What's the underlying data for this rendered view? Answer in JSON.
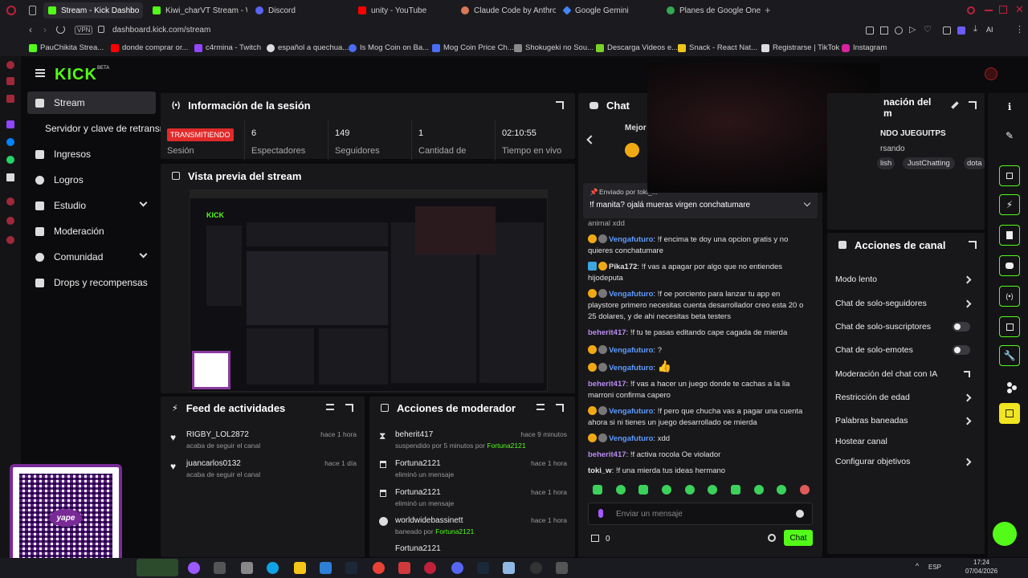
{
  "browser": {
    "tabs": [
      {
        "label": "Stream - Kick Dashbo",
        "color": "#53fc18",
        "active": true
      },
      {
        "label": "Kiwi_charVT Stream - Wa",
        "color": "#53fc18",
        "active": false
      },
      {
        "label": "Discord",
        "color": "#5865f2",
        "active": false
      },
      {
        "label": "unity - YouTube",
        "color": "#ff0000",
        "active": false
      },
      {
        "label": "Claude Code by Anthropi",
        "color": "#d97757",
        "active": false
      },
      {
        "label": "Google Gemini",
        "color": "#4285f4",
        "active": false
      },
      {
        "label": "Planes de Google One",
        "color": "#34a853",
        "active": false
      }
    ],
    "new_tab": "+",
    "vpn": "VPN",
    "url": "dashboard.kick.com/stream",
    "ai": "AI",
    "bookmarks": [
      "PauChikita Strea...",
      "donde comprar or...",
      "c4rmina - Twitch",
      "español a quechua...",
      "Is Mog Coin on Ba...",
      "Mog Coin Price Ch...",
      "Shokugeki no Sou...",
      "Descarga Videos e...",
      "Snack - React Nat...",
      "Registrarse | TikTok",
      "Instagram"
    ]
  },
  "kick": {
    "logo": "KICK",
    "beta": "BETA",
    "nav": [
      {
        "label": "Stream",
        "active": true,
        "icon": "stream-icon"
      },
      {
        "label": "Servidor y clave de retransm",
        "sub": true
      },
      {
        "label": "Ingresos",
        "icon": "bar-chart-icon"
      },
      {
        "label": "Logros",
        "icon": "trophy-icon"
      },
      {
        "label": "Estudio",
        "icon": "studio-icon",
        "chevron": true
      },
      {
        "label": "Moderación",
        "icon": "wrench-icon"
      },
      {
        "label": "Comunidad",
        "icon": "community-icon",
        "chevron": true
      },
      {
        "label": "Drops y recompensas",
        "icon": "drops-icon"
      }
    ]
  },
  "session": {
    "title": "Información de la sesión",
    "live_badge": "TRANSMITIENDO",
    "live_label": "Sesión",
    "stats": [
      {
        "value": "6",
        "label": "Espectadores"
      },
      {
        "value": "149",
        "label": "Seguidores"
      },
      {
        "value": "1",
        "label": "Cantidad de"
      },
      {
        "value": "02:10:55",
        "label": "Tiempo en vivo"
      }
    ]
  },
  "preview": {
    "title": "Vista previa del stream"
  },
  "feed": {
    "title": "Feed de actividades",
    "items": [
      {
        "user": "RIGBY_LOL2872",
        "action": "acaba de seguir el canal",
        "time": "hace 1 hora"
      },
      {
        "user": "juancarlos0132",
        "action": "acaba de seguir el canal",
        "time": "hace 1 día"
      }
    ]
  },
  "modactions": {
    "title": "Acciones de moderador",
    "items": [
      {
        "user": "beherit417",
        "action": "suspendido por 5 minutos por",
        "by": "Fortuna2121",
        "time": "hace 9 minutos"
      },
      {
        "user": "Fortuna2121",
        "action": "eliminó un mensaje",
        "by": "",
        "time": "hace 1 hora"
      },
      {
        "user": "Fortuna2121",
        "action": "eliminó un mensaje",
        "by": "",
        "time": "hace 1 hora"
      },
      {
        "user": "worldwidebassinett",
        "action": "baneado por",
        "by": "Fortuna2121",
        "time": "hace 1 hora"
      },
      {
        "user": "Fortuna2121",
        "action": "",
        "by": "",
        "time": ""
      }
    ]
  },
  "chat": {
    "title": "Chat",
    "top_label": "Mejor",
    "pinned_by": "Enviado por toki_...",
    "pinned_text": "!f manita? ojalá mueras virgen conchatumare",
    "partial_line": "animal xdd",
    "messages": [
      {
        "user": "Vengafuturo",
        "text": "!f encima te doy una opcion gratis y no quieres conchatumare",
        "style": "un"
      },
      {
        "user": "Pika172",
        "text": "!f vas a apagar por algo que no entiendes hijodeputa",
        "style": "un3"
      },
      {
        "user": "Vengafuturo",
        "text": "!f oe porciento para lanzar tu app en playstore primero necesitas cuenta desarrollador creo esta 20 o 25 dolares, y de ahi necesitas beta testers",
        "style": "un"
      },
      {
        "user": "beherit417",
        "text": "!f tu te pasas editando cape cagada de mierda",
        "style": "un2"
      },
      {
        "user": "Vengafuturo",
        "text": "?",
        "style": "un"
      },
      {
        "user": "Vengafuturo",
        "text": "👍",
        "style": "un"
      },
      {
        "user": "beherit417",
        "text": "!f vas a hacer un juego donde te cachas a la lia marroni confirma capero",
        "style": "un2"
      },
      {
        "user": "Vengafuturo",
        "text": "!f pero que chucha vas a pagar una cuenta ahora si ni tienes un juego desarrollado oe mierda",
        "style": "un"
      },
      {
        "user": "Vengafuturo",
        "text": "xdd",
        "style": "un"
      },
      {
        "user": "beherit417",
        "text": "!f activa rocola Oe violador",
        "style": "un2"
      },
      {
        "user": "toki_w",
        "text": "!f una mierda tus ideas hermano",
        "style": "un3"
      }
    ],
    "input_placeholder": "Enviar un mensaje",
    "count": "0",
    "send": "Chat"
  },
  "channel_info": {
    "title_part1": "nación del",
    "title_part2": "m",
    "streamer": "NDO JUEGUITPS",
    "status": "rsando",
    "tags": [
      "lish",
      "JustChatting",
      "dota"
    ]
  },
  "actions": {
    "title": "Acciones de canal",
    "items": [
      {
        "label": "Modo lento",
        "ctrl": "chevron"
      },
      {
        "label": "Chat de solo-seguidores",
        "ctrl": "chevron"
      },
      {
        "label": "Chat de solo-suscriptores",
        "ctrl": "toggle"
      },
      {
        "label": "Chat de solo-emotes",
        "ctrl": "toggle"
      },
      {
        "label": "Moderación del chat con IA",
        "ctrl": "external"
      },
      {
        "label": "Restricción de edad",
        "ctrl": "chevron"
      },
      {
        "label": "Palabras baneadas",
        "ctrl": "chevron"
      },
      {
        "label": "Hostear canal",
        "ctrl": "none"
      },
      {
        "label": "Configurar objetivos",
        "ctrl": "chevron"
      }
    ]
  },
  "overlay": {
    "yape": "yape"
  },
  "taskbar": {
    "lang": "ESP",
    "time": "17:24",
    "date": "07/04/2026"
  },
  "colors": {
    "kick_green": "#53fc18",
    "live_red": "#e12a2a",
    "accent_yellow": "#f0a912"
  }
}
